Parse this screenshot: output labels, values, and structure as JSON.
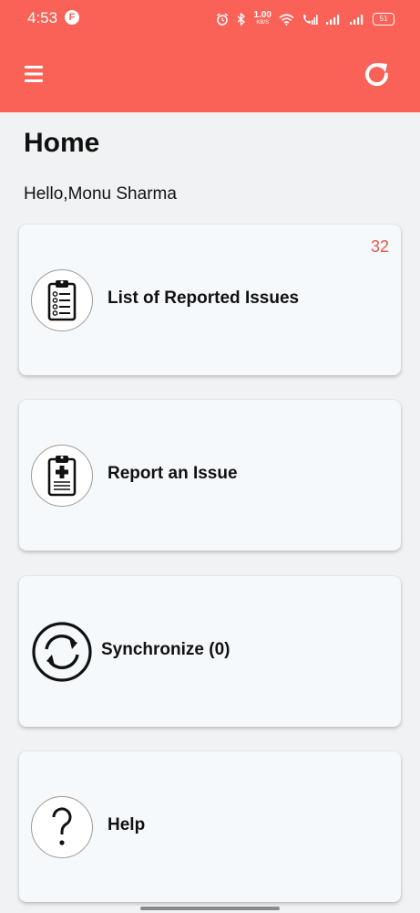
{
  "status_bar": {
    "time": "4:53",
    "app_icon_letter": "F",
    "net_speed_value": "1.00",
    "net_speed_unit": "KB/S",
    "battery": "51"
  },
  "app_bar": {
    "menu_icon": "hamburger-menu-icon",
    "refresh_icon": "refresh-icon",
    "background_color": "#fa6157"
  },
  "page": {
    "title": "Home",
    "greeting": "Hello,Monu Sharma"
  },
  "cards": [
    {
      "label": "List of Reported Issues",
      "badge": "32",
      "icon": "checklist-clipboard-icon"
    },
    {
      "label": "Report an Issue",
      "icon": "medical-clipboard-icon"
    },
    {
      "label": "Synchronize (0)",
      "icon": "sync-icon"
    },
    {
      "label": "Help",
      "icon": "question-mark-icon"
    }
  ]
}
